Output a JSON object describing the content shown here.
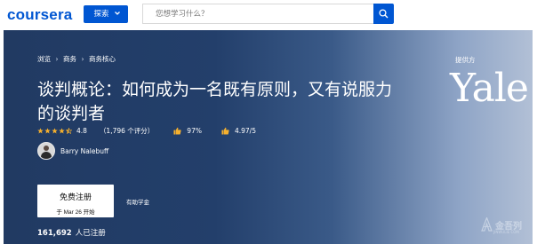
{
  "header": {
    "logo": "coursera",
    "explore_label": "探索",
    "search_placeholder": "您想学习什么？"
  },
  "breadcrumb": [
    "浏览",
    "商务",
    "商务核心"
  ],
  "course": {
    "title": "谈判概论：如何成为一名既有原则，又有说服力的谈判者",
    "rating": "4.8",
    "reviews": "（1,796 个评分）",
    "satisfaction": "97%",
    "score": "4.97/5",
    "stars_filled": 4.5,
    "instructor": "Barry Nalebuff"
  },
  "enroll": {
    "button_label": "免费注册",
    "start_date": "于 Mar 26 开始",
    "financial_aid": "有助学金",
    "enrolled_count": "161,692",
    "enrolled_suffix": "人已注册"
  },
  "provider": {
    "label": "提供方",
    "name": "Yale"
  },
  "watermark": {
    "text": "金吾列",
    "sub": "JINWULIE COM"
  },
  "colors": {
    "brand": "#0056d2",
    "star": "#f5b02e",
    "hero_dark": "#213a62",
    "hero_light": "#b2c0d6"
  },
  "icons": [
    "chevron-down-icon",
    "search-icon",
    "star-icon",
    "thumbs-up-icon",
    "avatar"
  ]
}
